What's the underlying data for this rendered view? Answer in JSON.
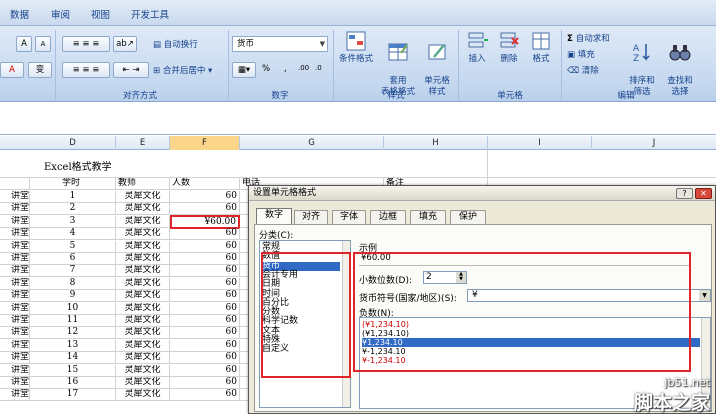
{
  "tabs": [
    "数据",
    "审阅",
    "视图",
    "开发工具"
  ],
  "ribbon": {
    "font_grow": "A",
    "font_shrink": "A",
    "font_color": "A",
    "phonetic": "变",
    "wrap_text": "自动换行",
    "merge_center": "合并后居中",
    "number_format": "货币",
    "percent": "%",
    "comma": ",",
    "inc_decimal": ".00",
    "dec_decimal": ".0",
    "cond_format": "条件格式",
    "table_format": "套用\n表格格式",
    "cell_style": "单元格\n样式",
    "insert": "插入",
    "delete": "删除",
    "format": "格式",
    "autosum": "自动求和",
    "fill": "填充",
    "clear": "清除",
    "sort_filter": "排序和\n筛选",
    "find_select": "查找和\n选择",
    "groups": [
      "对齐方式",
      "数字",
      "样式",
      "单元格",
      "编辑"
    ]
  },
  "columns": [
    "D",
    "E",
    "F",
    "G",
    "H",
    "I",
    "J"
  ],
  "sheet": {
    "title": "Excel格式教学",
    "headers": [
      "学时",
      "教师",
      "人数",
      "电话",
      "备注"
    ],
    "left_stub": "讲堂",
    "teacher": "灵犀文化",
    "count": "60",
    "currency_cell": "¥60.00",
    "rows": [
      "1",
      "2",
      "3",
      "4",
      "5",
      "6",
      "7",
      "8",
      "9",
      "10",
      "11",
      "12",
      "13",
      "14",
      "15",
      "16",
      "17"
    ]
  },
  "dialog": {
    "title": "设置单元格格式",
    "help": "?",
    "close": "✕",
    "tabs": [
      "数字",
      "对齐",
      "字体",
      "边框",
      "填充",
      "保护"
    ],
    "category_label": "分类(C):",
    "categories": [
      "常规",
      "数值",
      "货币",
      "会计专用",
      "日期",
      "时间",
      "百分比",
      "分数",
      "科学记数",
      "文本",
      "特殊",
      "自定义"
    ],
    "selected_category": "货币",
    "sample_label": "示例",
    "sample_value": "¥60.00",
    "decimal_label": "小数位数(D):",
    "decimal_value": "2",
    "symbol_label": "货币符号(国家/地区)(S):",
    "symbol_value": "¥",
    "negative_label": "负数(N):",
    "negative_options": [
      "(¥1,234.10)",
      "(¥1,234.10)",
      "¥1,234.10",
      "¥-1,234.10",
      "¥-1,234.10"
    ],
    "negative_colors": [
      "#cc0000",
      "#000000",
      "#ffffff",
      "#000000",
      "#cc0000"
    ],
    "negative_selected": 2
  },
  "watermark": {
    "url": "jb51.net",
    "name": "脚本之家"
  }
}
